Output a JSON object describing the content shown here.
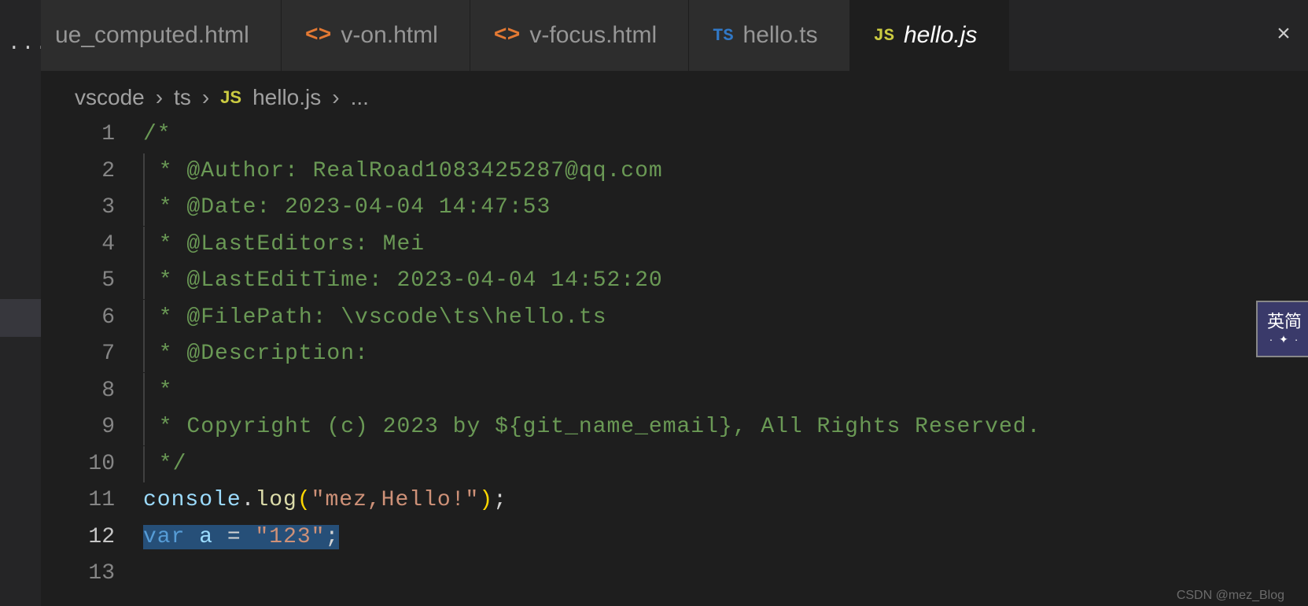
{
  "left_strip": {
    "dots": "..."
  },
  "tabs": [
    {
      "icon_type": "html",
      "label": "ue_computed.html"
    },
    {
      "icon_type": "html",
      "label": "v-on.html"
    },
    {
      "icon_type": "html",
      "label": "v-focus.html"
    },
    {
      "icon_type": "ts",
      "label": "hello.ts"
    },
    {
      "icon_type": "js",
      "label": "hello.js",
      "active": true
    }
  ],
  "tab_close_glyph": "×",
  "breadcrumbs": {
    "parts": [
      "vscode",
      "ts"
    ],
    "file_icon": "js",
    "file": "hello.js",
    "trailing": "..."
  },
  "code": {
    "l1": "/*",
    "l2": " * @Author: RealRoad1083425287@qq.com",
    "l3": " * @Date: 2023-04-04 14:47:53",
    "l4": " * @LastEditors: Mei",
    "l5": " * @LastEditTime: 2023-04-04 14:52:20",
    "l6": " * @FilePath: \\vscode\\ts\\hello.ts",
    "l7": " * @Description: ",
    "l8": " * ",
    "l9": " * Copyright (c) 2023 by ${git_name_email}, All Rights Reserved. ",
    "l10": " */",
    "l11_obj": "console",
    "l11_dot": ".",
    "l11_fn": "log",
    "l11_open": "(",
    "l11_str": "\"mez,Hello!\"",
    "l11_close": ")",
    "l11_semi": ";",
    "l12_kw": "var",
    "l12_sp1": " ",
    "l12_name": "a",
    "l12_eq": " = ",
    "l12_str": "\"123\"",
    "l12_semi": ";"
  },
  "line_numbers": [
    "1",
    "2",
    "3",
    "4",
    "5",
    "6",
    "7",
    "8",
    "9",
    "10",
    "11",
    "12",
    "13"
  ],
  "icons": {
    "html": "<>",
    "ts": "TS",
    "js": "JS"
  },
  "watermark": "CSDN @mez_Blog",
  "widget": {
    "text": "英简",
    "sub": "· ✦ ·"
  }
}
